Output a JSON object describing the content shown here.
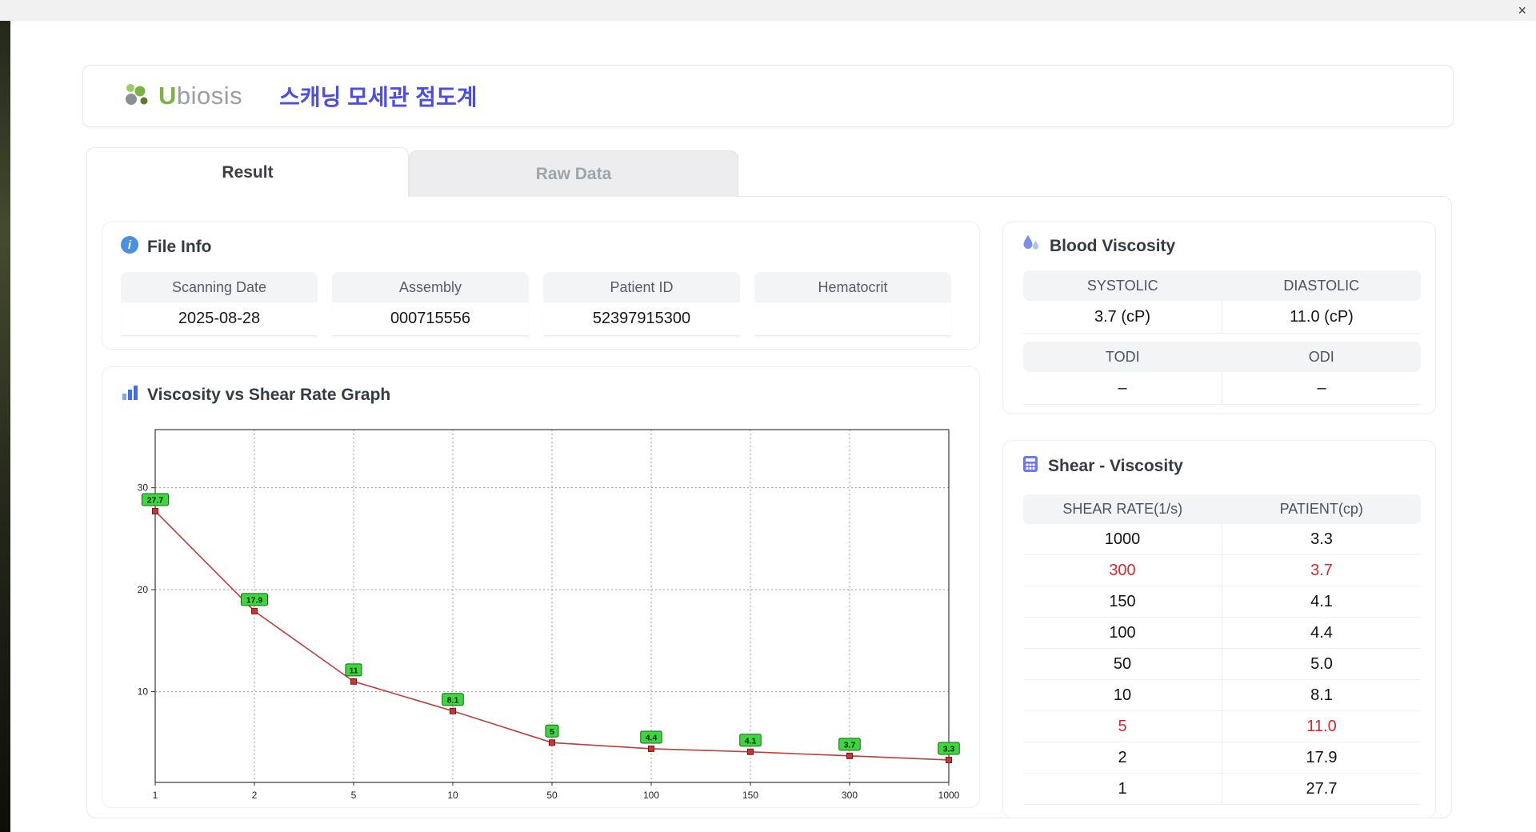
{
  "window": {
    "close_icon": "×"
  },
  "header": {
    "logo_u": "U",
    "logo_rest": "biosis",
    "app_title": "스캐닝 모세관 점도계"
  },
  "tabs": {
    "result": "Result",
    "raw_data": "Raw Data"
  },
  "file_info": {
    "title": "File Info",
    "fields": [
      {
        "label": "Scanning Date",
        "value": "2025-08-28"
      },
      {
        "label": "Assembly",
        "value": "000715556"
      },
      {
        "label": "Patient ID",
        "value": "52397915300"
      },
      {
        "label": "Hematocrit",
        "value": ""
      }
    ]
  },
  "graph_section": {
    "title": "Viscosity vs Shear Rate Graph"
  },
  "blood_viscosity": {
    "title": "Blood Viscosity",
    "cells": [
      {
        "label": "SYSTOLIC",
        "value": "3.7 (cP)"
      },
      {
        "label": "DIASTOLIC",
        "value": "11.0 (cP)"
      },
      {
        "label": "TODI",
        "value": "–"
      },
      {
        "label": "ODI",
        "value": "–"
      }
    ]
  },
  "shear_viscosity": {
    "title": "Shear - Viscosity",
    "columns": [
      "SHEAR RATE(1/s)",
      "PATIENT(cp)"
    ],
    "rows": [
      {
        "shear_rate": "1000",
        "patient": "3.3",
        "highlight": false
      },
      {
        "shear_rate": "300",
        "patient": "3.7",
        "highlight": true
      },
      {
        "shear_rate": "150",
        "patient": "4.1",
        "highlight": false
      },
      {
        "shear_rate": "100",
        "patient": "4.4",
        "highlight": false
      },
      {
        "shear_rate": "50",
        "patient": "5.0",
        "highlight": false
      },
      {
        "shear_rate": "10",
        "patient": "8.1",
        "highlight": false
      },
      {
        "shear_rate": "5",
        "patient": "11.0",
        "highlight": true
      },
      {
        "shear_rate": "2",
        "patient": "17.9",
        "highlight": false
      },
      {
        "shear_rate": "1",
        "patient": "27.7",
        "highlight": false
      }
    ]
  },
  "chart_data": {
    "type": "line",
    "title": "Viscosity vs Shear Rate Graph",
    "x_axis_type": "category",
    "categories": [
      "1",
      "2",
      "5",
      "10",
      "50",
      "100",
      "150",
      "300",
      "1000"
    ],
    "values": [
      27.7,
      17.9,
      11,
      8.1,
      5,
      4.4,
      4.1,
      3.7,
      3.3
    ],
    "point_labels": [
      "27.7",
      "17.9",
      "11",
      "8.1",
      "5",
      "4.4",
      "4.1",
      "3.7",
      "3.3"
    ],
    "y_ticks": [
      10,
      20,
      30
    ],
    "ylim": [
      1.1,
      35.7
    ],
    "grid": true,
    "line_color": "#c23b3b",
    "marker_color": "#cc3333",
    "label_bg": "#3ed63e"
  }
}
